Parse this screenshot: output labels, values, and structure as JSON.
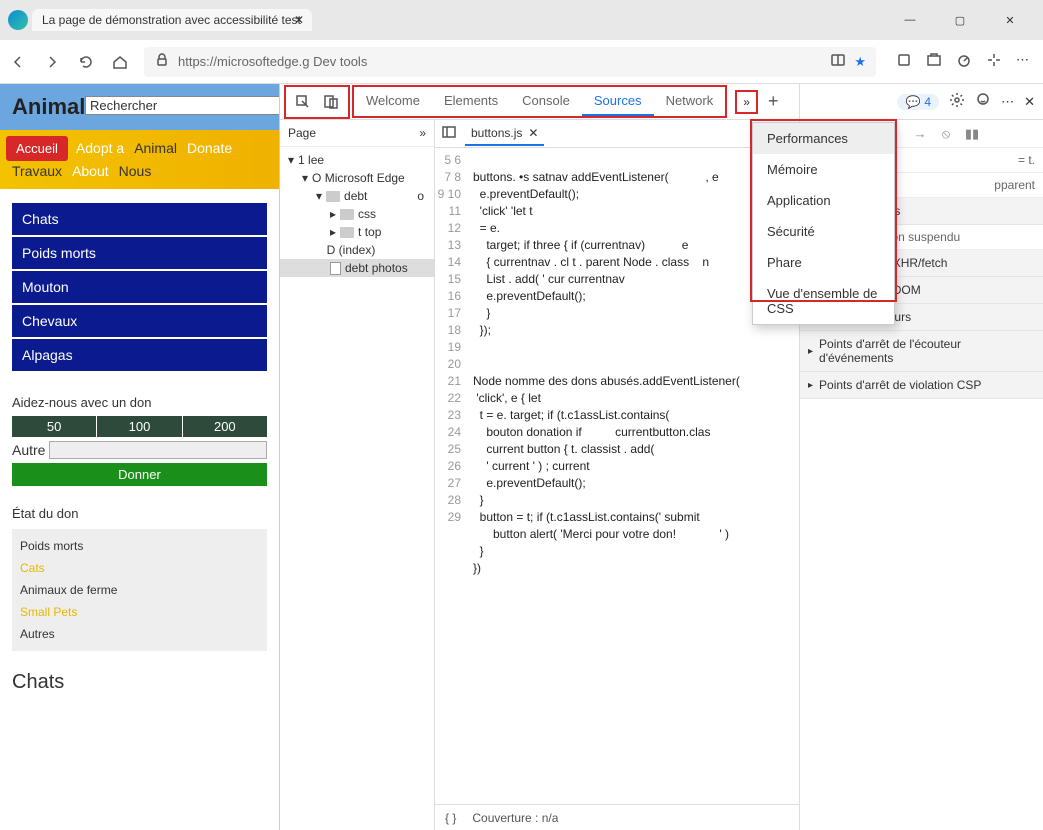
{
  "window": {
    "title": "La page de démonstration avec accessibilité test"
  },
  "browser": {
    "url_display": "https://microsoftedge.g Dev tools",
    "nav": {
      "back": "←",
      "forward": "→",
      "reload": "↻",
      "home": "⌂"
    }
  },
  "page": {
    "title": "Animal shelter",
    "search_placeholder": "Rechercher",
    "nav": {
      "home": "Accueil",
      "adopt": "Adopt a",
      "animal": "Animal",
      "donate": "Donate",
      "travaux": "Travaux",
      "about": "About",
      "nous": "Nous"
    },
    "categories": [
      "Chats",
      "Poids morts",
      "Mouton",
      "Chevaux",
      "Alpagas"
    ],
    "donate": {
      "title": "Aidez-nous avec un don",
      "amounts": [
        "50",
        "100",
        "200"
      ],
      "other": "Autre",
      "button": "Donner"
    },
    "status": {
      "title": "État du don",
      "items": [
        "Poids morts",
        "Cats",
        "Animaux de ferme",
        "Small Pets",
        "Autres"
      ]
    },
    "section": "Chats"
  },
  "devtools": {
    "tabs": [
      "Welcome",
      "Elements",
      "Console",
      "Sources",
      "Network"
    ],
    "active_tab": "Sources",
    "more_menu": [
      "Performances",
      "Mémoire",
      "Application",
      "Sécurité",
      "Phare",
      "Vue d'ensemble de CSS"
    ],
    "issues_count": "4",
    "tree_head": "Page",
    "tree": {
      "root": "1 lee",
      "site": "O Microsoft Edge",
      "debt": "debt",
      "o": "o",
      "css": "css",
      "ttop": "t top",
      "index": "D (index)",
      "photos": "debt photos"
    },
    "editor_tab": "buttons.js",
    "gutter": [
      "5",
      "6",
      "7",
      "8",
      "9",
      "10",
      "11",
      "12",
      "13",
      "14",
      "15",
      "16",
      "17",
      "18",
      "19",
      "20",
      "21",
      "22",
      "23",
      "24",
      "25",
      "26",
      "27",
      "28",
      "29"
    ],
    "code": [
      "",
      "buttons. •s satnav addEventListener(           , e",
      "  e.preventDefault();",
      "  'click' 'let t",
      "  = e.",
      "    target; if three { if (currentnav)           e",
      "    { currentnav . cl t . parent Node . class    n",
      "    List . add( ' cur currentnav",
      "    e.preventDefault();",
      "    }",
      "  });",
      "",
      "",
      "Node nomme des dons abusés.addEventListener(",
      " 'click', e { let",
      "  t = e. target; if (t.c1assList.contains(",
      "    bouton donation if          currentbutton.clas",
      "    current button { t. classist . add(",
      "    ' current ' ) ; current",
      "    e.preventDefault();",
      "  }",
      "  button = t; if (t.c1assList.contains(' submit",
      "      button alert( 'Merci pour votre don!             ' )",
      "  }",
      "})"
    ],
    "footer": {
      "braces": "{ }",
      "coverage": "Couverture : n/a"
    },
    "dbg": {
      "scope_hint": "= t.",
      "parent": "pparent",
      "callstack": "Pile des appels",
      "not_paused": "Non suspendu",
      "sections": [
        "Points d'arrêt XHR/fetch",
        "Points d'arrêt DOM",
        "Global  Écouteurs",
        "Points d'arrêt de l'écouteur d'événements",
        "Points d'arrêt de violation CSP"
      ]
    }
  }
}
